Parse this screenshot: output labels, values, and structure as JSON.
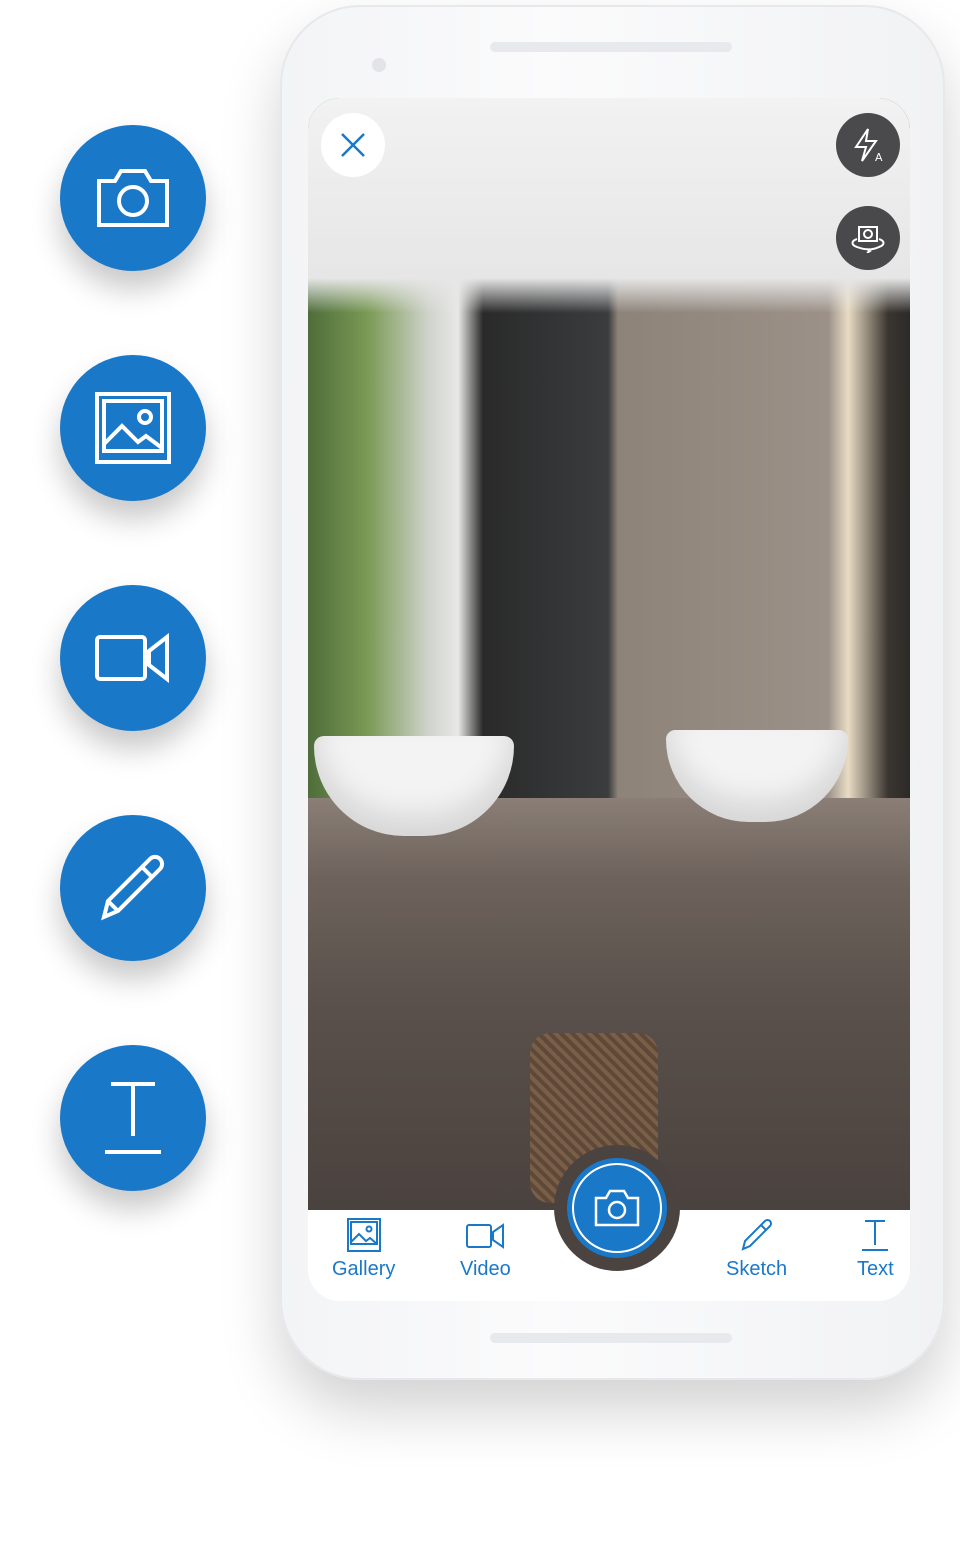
{
  "colors": {
    "accent": "#1a78c9",
    "shutter_ring": "#4b4340"
  },
  "side_actions": [
    {
      "icon": "camera-icon"
    },
    {
      "icon": "image-icon"
    },
    {
      "icon": "video-icon"
    },
    {
      "icon": "pencil-icon"
    },
    {
      "icon": "text-icon"
    }
  ],
  "camera": {
    "top_controls": [
      {
        "icon": "close-icon"
      },
      {
        "icon": "flash-auto-icon"
      },
      {
        "icon": "switch-camera-icon"
      }
    ],
    "bottom_bar": {
      "tabs": [
        {
          "label": "Gallery",
          "icon": "image-icon"
        },
        {
          "label": "Video",
          "icon": "video-icon"
        },
        {
          "label": "Sketch",
          "icon": "pencil-icon"
        },
        {
          "label": "Text",
          "icon": "text-icon"
        }
      ],
      "shutter": {
        "icon": "camera-icon"
      }
    }
  }
}
